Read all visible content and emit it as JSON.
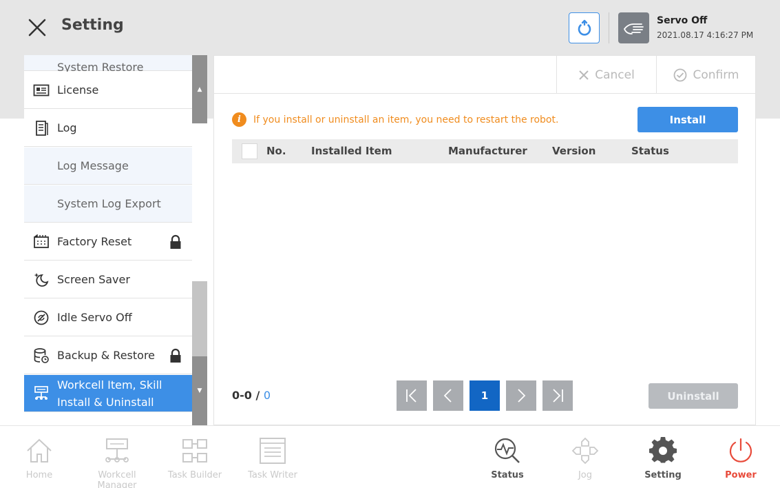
{
  "header": {
    "title": "Setting",
    "servo_status": "Servo Off",
    "datetime": "2021.08.17 4:16:27 PM"
  },
  "menu": {
    "items": [
      {
        "label": "System Restore",
        "sub": true
      },
      {
        "label": "License",
        "icon": "license-icon"
      },
      {
        "label": "Log",
        "icon": "log-icon"
      },
      {
        "label": "Log Message",
        "sub": true
      },
      {
        "label": "System Log Export",
        "sub": true
      },
      {
        "label": "Factory Reset",
        "icon": "factory-reset-icon",
        "locked": true
      },
      {
        "label": "Screen Saver",
        "icon": "moon-star-icon"
      },
      {
        "label": "Idle Servo Off",
        "icon": "idle-servo-icon"
      },
      {
        "label": "Backup & Restore",
        "icon": "database-icon",
        "locked": true
      },
      {
        "label": "Workcell Item, Skill Install & Uninstall",
        "icon": "workcell-icon",
        "selected": true
      }
    ]
  },
  "toolbar": {
    "cancel_label": "Cancel",
    "confirm_label": "Confirm"
  },
  "notice": "If you install or uninstall an item, you need to restart the robot.",
  "install_label": "Install",
  "uninstall_label": "Uninstall",
  "table": {
    "columns": [
      "No.",
      "Installed Item",
      "Manufacturer",
      "Version",
      "Status"
    ]
  },
  "pagination": {
    "range": "0-0",
    "separator": "/",
    "total": "0",
    "current_page": "1"
  },
  "bottom_nav": [
    {
      "label": "Home",
      "icon": "home-icon"
    },
    {
      "label": "Workcell Manager",
      "icon": "workcell-manager-icon"
    },
    {
      "label": "Task Builder",
      "icon": "task-builder-icon"
    },
    {
      "label": "Task Writer",
      "icon": "task-writer-icon"
    },
    {
      "label": "Status",
      "icon": "status-icon"
    },
    {
      "label": "Jog",
      "icon": "jog-icon"
    },
    {
      "label": "Setting",
      "icon": "gear-icon"
    },
    {
      "label": "Power",
      "icon": "power-icon"
    }
  ],
  "colors": {
    "accent": "#3d8fe6",
    "warning": "#f08c1e",
    "power": "#e84a3a",
    "active_page": "#1266c4"
  }
}
